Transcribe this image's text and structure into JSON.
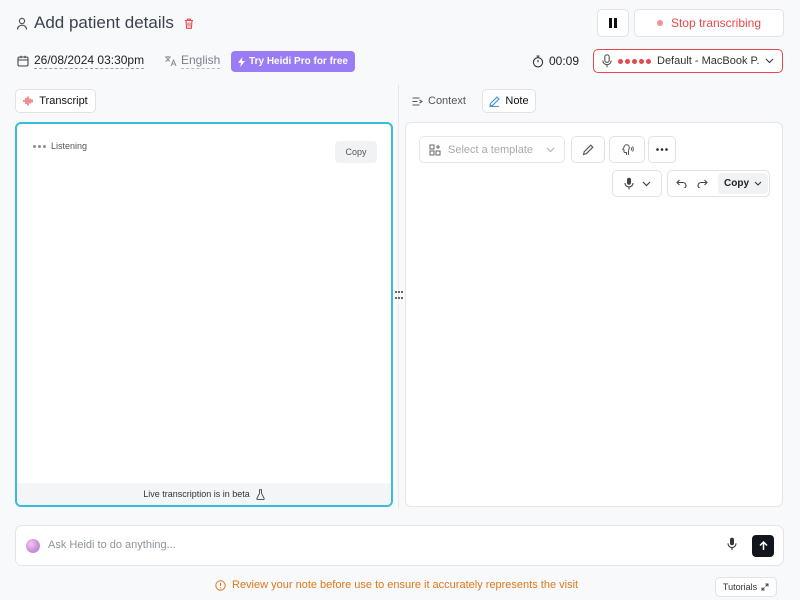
{
  "header": {
    "title": "Add patient details",
    "stop_label": "Stop transcribing"
  },
  "session": {
    "datetime": "26/08/2024 03:30pm",
    "language": "English",
    "promo_label": "Try Heidi Pro for free",
    "timer": "00:09",
    "input_device": "Default - MacBook P..."
  },
  "transcript": {
    "tab_label": "Transcript",
    "status": "Listening",
    "copy_label": "Copy",
    "beta_note": "Live transcription is in beta"
  },
  "note": {
    "context_tab": "Context",
    "note_tab": "Note",
    "template_placeholder": "Select a template",
    "copy_label": "Copy"
  },
  "ask": {
    "placeholder": "Ask Heidi to do anything..."
  },
  "footer": {
    "review_notice": "Review your note before use to ensure it accurately represents the visit",
    "tutorials_label": "Tutorials"
  },
  "colors": {
    "accent_purple": "#9a7cf5",
    "recording_red": "#e5484d",
    "focus_cyan": "#38bdd8",
    "warning_orange": "#e0781a"
  }
}
